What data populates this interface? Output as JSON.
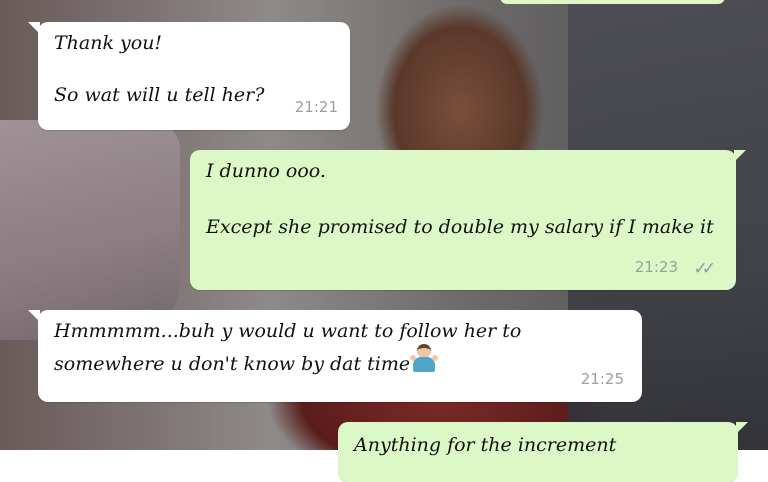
{
  "chat": {
    "messages": [
      {
        "direction": "incoming",
        "lines": [
          "Thank you!",
          "",
          "So wat will u tell her?"
        ],
        "time": "21:21"
      },
      {
        "direction": "outgoing",
        "lines": [
          "I dunno ooo.",
          "",
          "Except she promised to double my salary if I make it"
        ],
        "time": "21:23",
        "status_icon": "double-check-icon",
        "status_glyph": "✓✓"
      },
      {
        "direction": "incoming",
        "lines": [
          "Hmmmmm...buh y would u want to follow her to",
          "somewhere u don't know by dat time"
        ],
        "emoji": "person-shrugging-icon",
        "time": "21:25"
      },
      {
        "direction": "outgoing",
        "lines": [
          "Anything for the increment"
        ],
        "partially_visible": true
      }
    ]
  },
  "colors": {
    "incoming_bubble": "#ffffff",
    "outgoing_bubble": "#dcf8c6",
    "timestamp": "#9aa09a"
  }
}
